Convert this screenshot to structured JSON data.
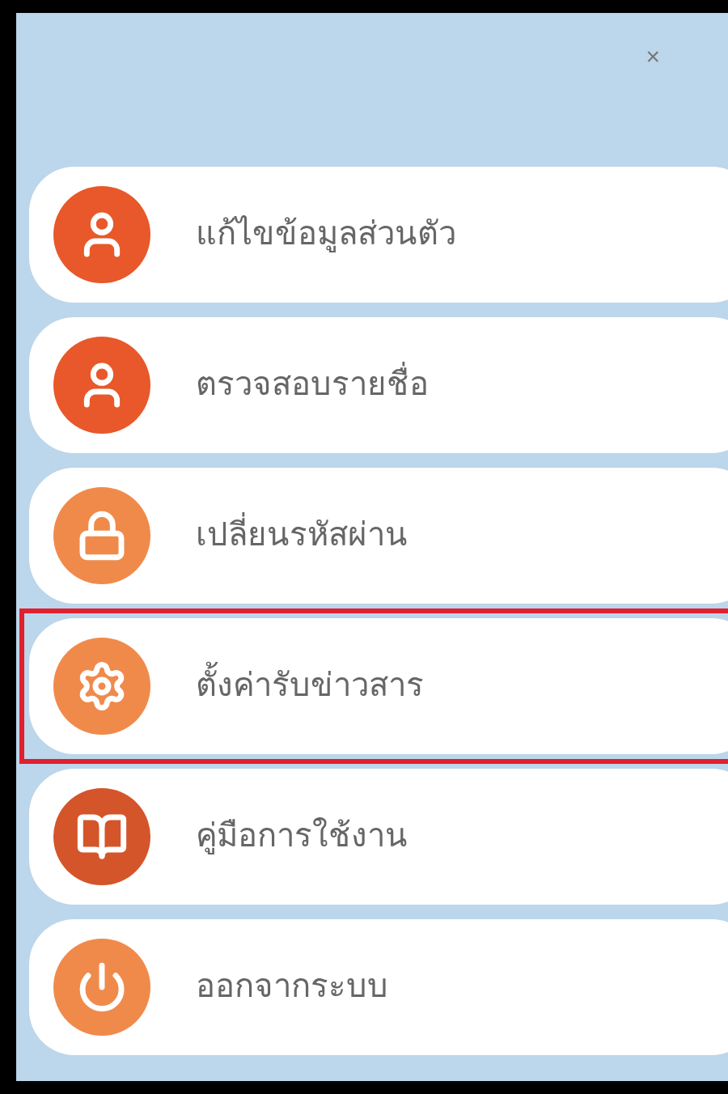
{
  "close_label": "×",
  "menu_items": [
    {
      "label": "แก้ไขข้อมูลส่วนตัว",
      "kind": "person",
      "color": "#e8582a",
      "selected": false
    },
    {
      "label": "ตรวจสอบรายชื่อ",
      "kind": "person",
      "color": "#e8582a",
      "selected": false
    },
    {
      "label": "เปลี่ยนรหัสผ่าน",
      "kind": "lock",
      "color": "#f08a4b",
      "selected": false
    },
    {
      "label": "ตั้งค่ารับข่าวสาร",
      "kind": "gear",
      "color": "#f08a4b",
      "selected": true
    },
    {
      "label": "คู่มือการใช้งาน",
      "kind": "book",
      "color": "#d4552a",
      "selected": false
    },
    {
      "label": "ออกจากระบบ",
      "kind": "power",
      "color": "#f08a4b",
      "selected": false
    }
  ]
}
